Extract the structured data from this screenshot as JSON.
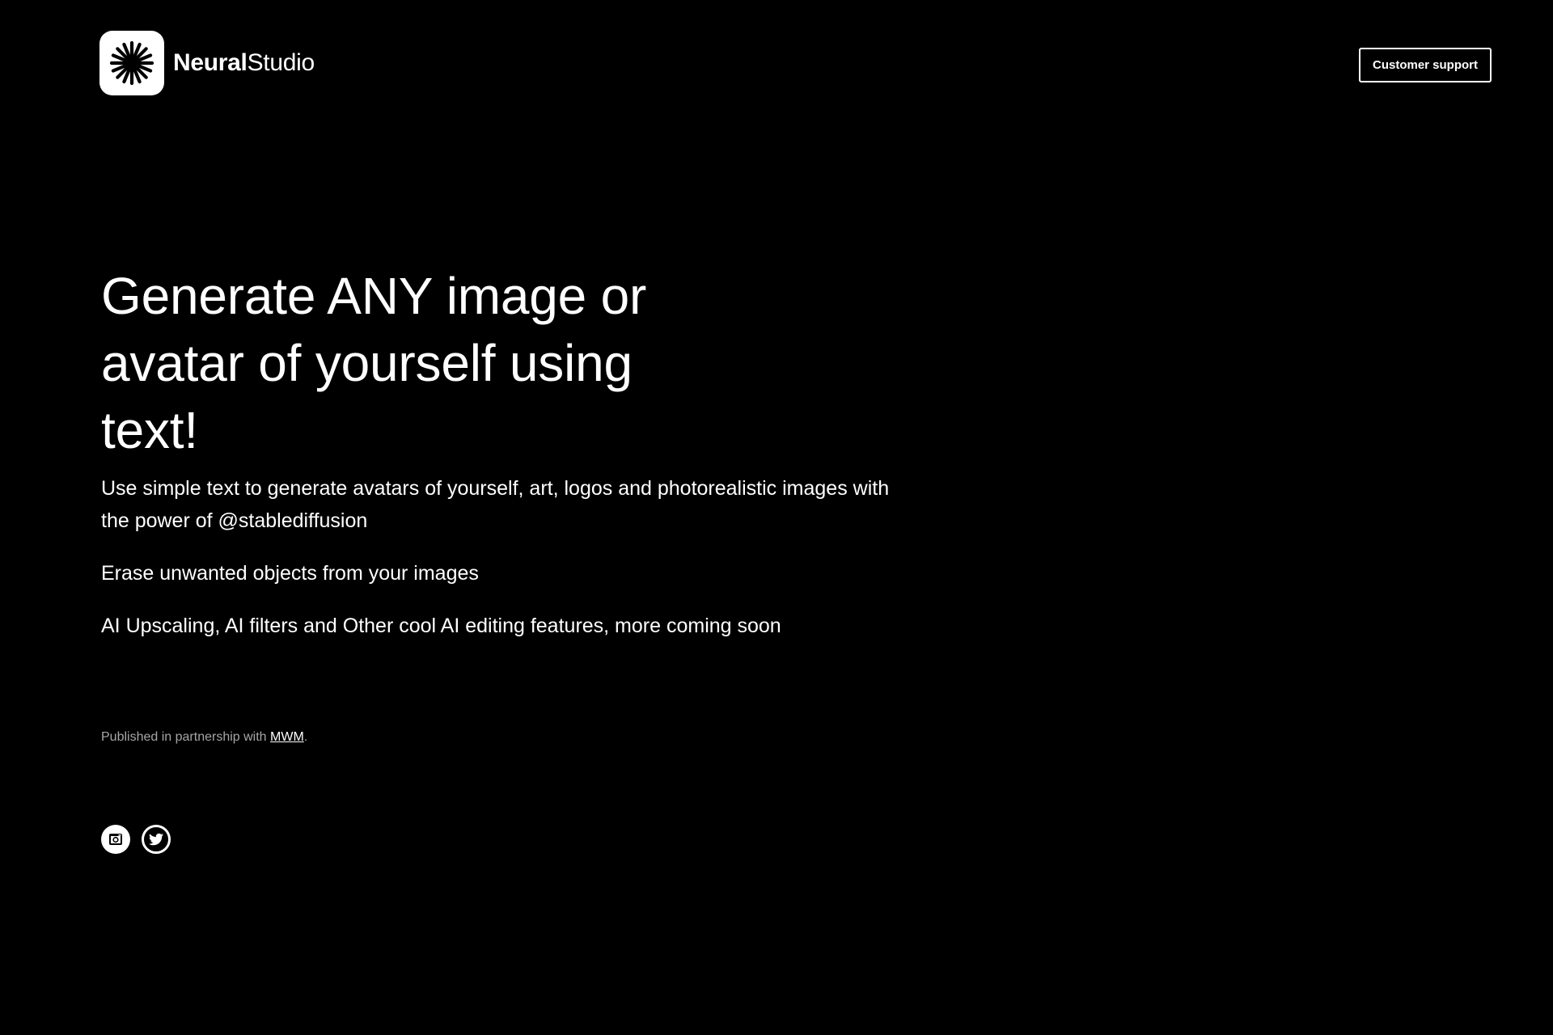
{
  "brand": {
    "name_bold": "Neural",
    "name_light": "Studio",
    "logo_icon": "asterisk-burst-icon"
  },
  "header": {
    "support_label": "Customer support"
  },
  "hero": {
    "title": "Generate ANY image or avatar of yourself using text!",
    "description": "Use simple text to generate avatars of yourself, art, logos and photorealistic images with the power of @stablediffusion",
    "features": [
      "Erase unwanted objects from your images",
      "AI Upscaling, AI filters and Other cool AI editing features, more coming soon"
    ]
  },
  "footer": {
    "partnership_prefix": "Published in partnership with ",
    "partner_name": "MWM",
    "partnership_suffix": ".",
    "social": [
      {
        "icon": "instagram-icon"
      },
      {
        "icon": "twitter-icon"
      }
    ]
  },
  "colors": {
    "background": "#000000",
    "text": "#ffffff",
    "muted_text": "#a6a6a6"
  }
}
